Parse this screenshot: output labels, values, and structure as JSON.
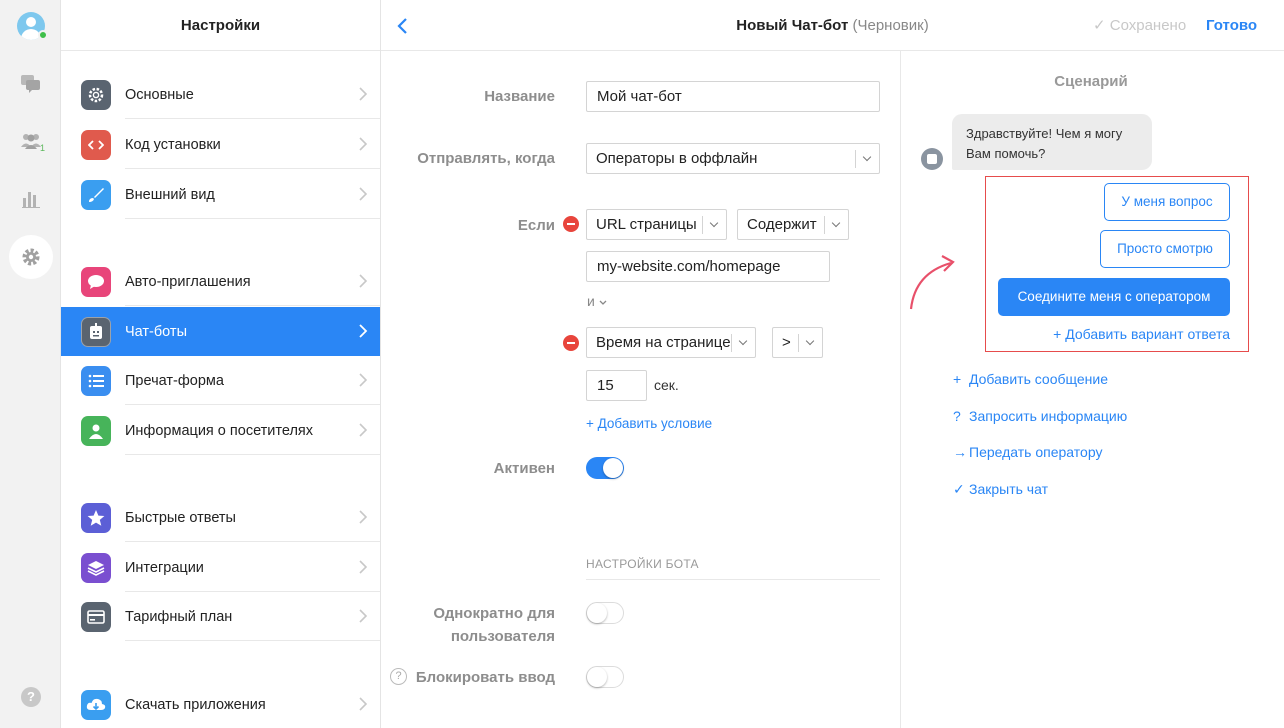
{
  "colors": {
    "accent": "#2a86f5",
    "danger": "#e8453c",
    "highlight_border": "#e64c4c",
    "online": "#3fbf4a"
  },
  "rail": {
    "icons": [
      "avatar-icon",
      "chat-bubbles-icon",
      "visitors-icon",
      "stats-icon",
      "gear-icon",
      "help-icon"
    ],
    "visitors_badge": "1",
    "help_label": "?"
  },
  "settings": {
    "title": "Настройки",
    "items": [
      {
        "label": "Основные",
        "icon": "gear-icon",
        "color": "#5a6470"
      },
      {
        "label": "Код установки",
        "icon": "code-icon",
        "color": "#e05a4d"
      },
      {
        "label": "Внешний вид",
        "icon": "brush-icon",
        "color": "#3a9ef0"
      },
      {
        "label": "Авто-приглашения",
        "icon": "speech-bubble-icon",
        "color": "#e8457a"
      },
      {
        "label": "Чат-боты",
        "icon": "bot-icon",
        "color": "#5a6470",
        "active": true
      },
      {
        "label": "Пречат-форма",
        "icon": "list-icon",
        "color": "#3a8ef0"
      },
      {
        "label": "Информация о посетителях",
        "icon": "person-card-icon",
        "color": "#47b45a"
      },
      {
        "label": "Быстрые ответы",
        "icon": "star-icon",
        "color": "#5c5fd6"
      },
      {
        "label": "Интеграции",
        "icon": "layers-icon",
        "color": "#7a4fd0"
      },
      {
        "label": "Тарифный план",
        "icon": "credit-card-icon",
        "color": "#5a6470"
      },
      {
        "label": "Скачать приложения",
        "icon": "cloud-download-icon",
        "color": "#3a9ef0"
      }
    ]
  },
  "topbar": {
    "title": "Новый Чат-бот",
    "draft": "(Черновик)",
    "saved": "✓ Сохранено",
    "done": "Готово"
  },
  "form": {
    "name_label": "Название",
    "name_value": "Мой чат-бот",
    "send_when_label": "Отправлять, когда",
    "send_when_value": "Операторы в оффлайн",
    "if_label": "Если",
    "cond1_field": "URL страницы",
    "cond1_operator": "Содержит",
    "cond1_value": "my-website.com/homepage",
    "and_label": "и",
    "cond2_field": "Время на странице",
    "cond2_operator": ">",
    "cond2_value": "15",
    "cond2_unit": "сек.",
    "add_condition": "+ Добавить условие",
    "active_label": "Активен",
    "active_on": true,
    "bot_settings_header": "НАСТРОЙКИ БОТА",
    "once_label_1": "Однократно для",
    "once_label_2": "пользователя",
    "once_on": false,
    "block_input_label": "Блокировать ввод",
    "block_input_on": false,
    "help_q": "?"
  },
  "scenario": {
    "title": "Сценарий",
    "bot_message": "Здравствуйте! Чем я могу Вам помочь?",
    "reply_1": "У меня вопрос",
    "reply_2": "Просто смотрю",
    "reply_3": "Соедините меня с оператором",
    "add_reply": "+ Добавить вариант ответа",
    "actions": [
      {
        "prefix": "+",
        "label": "Добавить сообщение"
      },
      {
        "prefix": "?",
        "label": "Запросить информацию"
      },
      {
        "prefix": "→",
        "label": "Передать оператору"
      },
      {
        "prefix": "✓",
        "label": "Закрыть чат"
      }
    ]
  }
}
